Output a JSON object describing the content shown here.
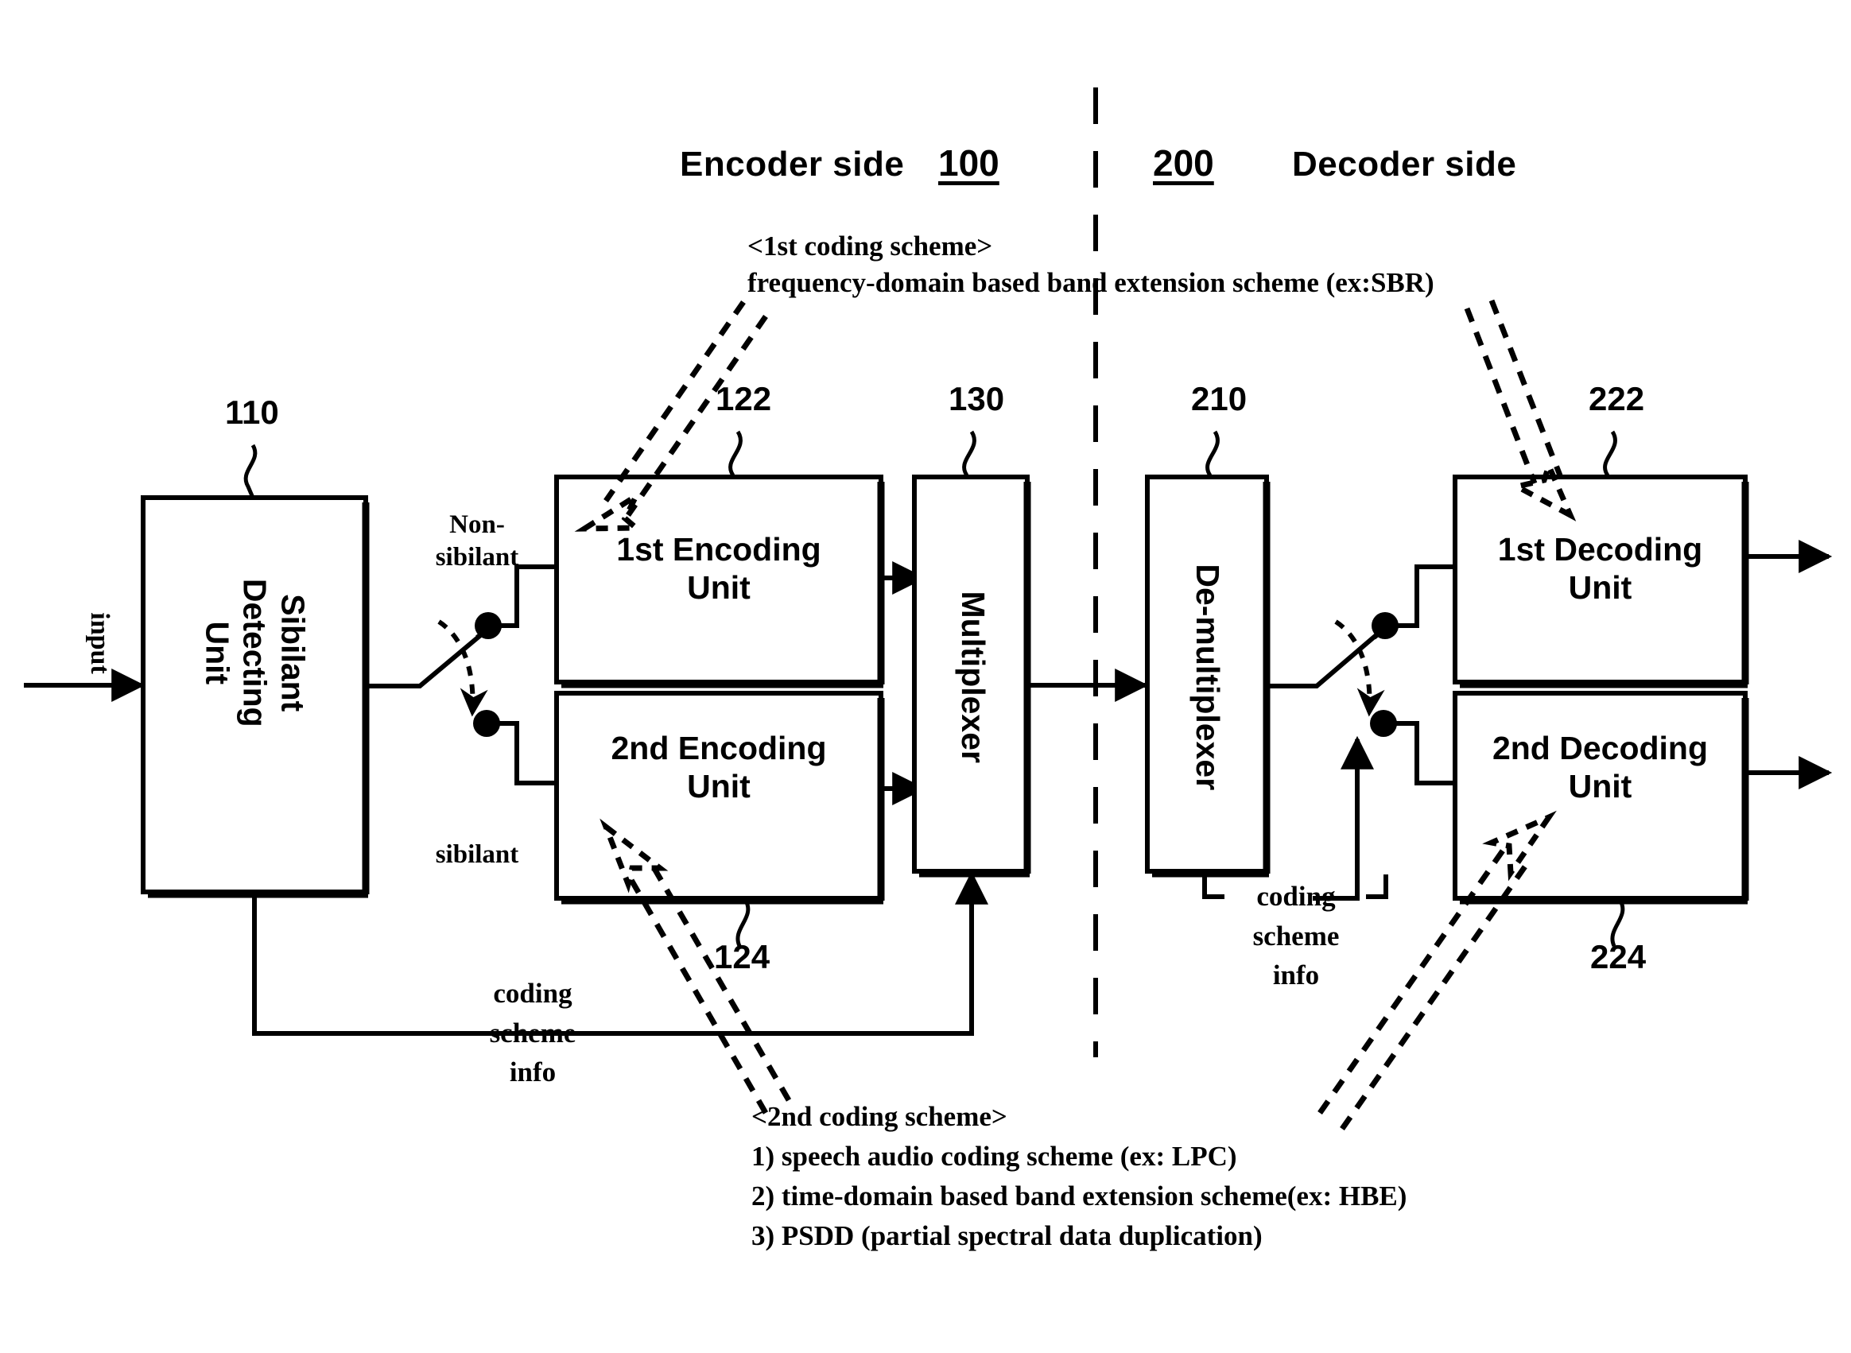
{
  "figure": {
    "type": "patent-block-diagram",
    "headers": {
      "encoder_side_label": "Encoder side",
      "encoder_side_number": "100",
      "decoder_side_label": "Decoder side",
      "decoder_side_number": "200"
    },
    "annotations": {
      "first_scheme_title": "<1st coding scheme>",
      "first_scheme_line1": "frequency-domain based band extension scheme (ex:SBR)",
      "second_scheme_title": "<2nd coding scheme>",
      "second_scheme_line1": "1) speech audio coding scheme (ex: LPC)",
      "second_scheme_line2": "2) time-domain based band extension scheme(ex: HBE)",
      "second_scheme_line3": "3) PSDD (partial spectral data duplication)"
    },
    "blocks": {
      "sibilant_detecting_unit": {
        "label": "Sibilant\nDetecting\nUnit",
        "ref": "110"
      },
      "first_encoding_unit": {
        "label": "1st Encoding\nUnit",
        "ref": "122"
      },
      "second_encoding_unit": {
        "label": "2nd Encoding\nUnit",
        "ref": "124"
      },
      "multiplexer": {
        "label": "Multiplexer",
        "ref": "130"
      },
      "demultiplexer": {
        "label": "De-multiplexer",
        "ref": "210"
      },
      "first_decoding_unit": {
        "label": "1st Decoding\nUnit",
        "ref": "222"
      },
      "second_decoding_unit": {
        "label": "2nd Decoding\nUnit",
        "ref": "224"
      }
    },
    "signals": {
      "input_label": "input",
      "non_sibilant_label": "Non-\nsibilant",
      "sibilant_label": "sibilant",
      "encoder_coding_scheme_info": "coding\nscheme\ninfo",
      "decoder_coding_scheme_info": "coding\nscheme\ninfo"
    },
    "colors": {
      "line": "#000000",
      "background": "#ffffff"
    }
  }
}
